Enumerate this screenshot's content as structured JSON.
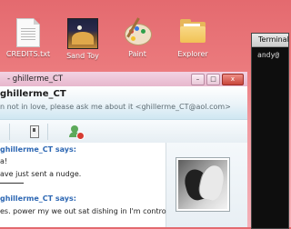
{
  "desktop": {
    "icons": [
      {
        "label": "CREDITS.txt",
        "icon": "text-file-icon"
      },
      {
        "label": "Sand Toy",
        "icon": "sand-toy-icon"
      },
      {
        "label": "Paint",
        "icon": "paint-palette-icon"
      },
      {
        "label": "Explorer",
        "icon": "folder-icon"
      }
    ]
  },
  "terminal": {
    "title": "Terminal",
    "prompt": "andy@"
  },
  "chat": {
    "window_title": "- ghillerme_CT",
    "window_buttons": {
      "minimize": "–",
      "maximize": "□",
      "close": "x"
    },
    "contact_name": "ghillerme_CT",
    "personal_message": "n not in love, please ask me about it <ghillerme_CT@aol.com>",
    "toolbar": [
      "game-icon",
      "block-contact-icon"
    ],
    "conversation": [
      {
        "type": "says",
        "text": "ghillerme_CT says:"
      },
      {
        "type": "msg",
        "text": "a!"
      },
      {
        "type": "msg",
        "text": "ave just sent a nudge."
      },
      {
        "type": "divider"
      },
      {
        "type": "says",
        "text": "ghillerme_CT says:"
      },
      {
        "type": "msg",
        "text": "es. power my we out sat dishing in I'm control now."
      }
    ],
    "avatar": "horses-avatar"
  },
  "colors": {
    "desktop_gradient_top": "#e46a6f",
    "link_blue": "#2d67b3",
    "close_red": "#c8463b"
  }
}
